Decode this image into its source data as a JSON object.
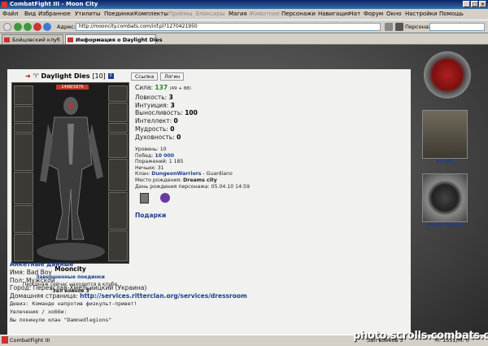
{
  "window": {
    "title": "CombatFight III - Moon City"
  },
  "menu": [
    "Файл",
    "Вид",
    "Избранное",
    "Утилиты",
    "Поединки",
    "Комплекты",
    "Приёмы",
    "Эликсиры",
    "Магия",
    "Животное",
    "Персонажи",
    "Навигация",
    "Чат",
    "Форум",
    "Окно",
    "Настройки",
    "Помощь"
  ],
  "address": {
    "label": "Адрес:",
    "url": "http://mooncity.combats.com/inf.pl?1270421950",
    "persona_label": "Персонаж:"
  },
  "tabs": [
    {
      "label": "Бойцовский клуб"
    },
    {
      "label": "Информация о Daylight Dies"
    }
  ],
  "character": {
    "name": "Daylight Dies",
    "level": "[10]",
    "hp": "1498/1870",
    "link_label": "Ссылка",
    "login_label": "Логин",
    "city": "Mooncity",
    "fights_link": "Завершенные поединки",
    "location_text": "Персонаж сейчас находится в клубе.",
    "location_room": "\"Зал воинов 3\""
  },
  "stats": [
    {
      "label": "Сила:",
      "value": "137",
      "extra": "(49 + 88)"
    },
    {
      "label": "Ловкость:",
      "value": "3",
      "extra": ""
    },
    {
      "label": "Интуиция:",
      "value": "3",
      "extra": ""
    },
    {
      "label": "Выносливость:",
      "value": "100",
      "extra": ""
    },
    {
      "label": "Интеллект:",
      "value": "0",
      "extra": ""
    },
    {
      "label": "Мудрость:",
      "value": "0",
      "extra": ""
    },
    {
      "label": "Духовность:",
      "value": "0",
      "extra": ""
    }
  ],
  "info": [
    {
      "label": "Уровень:",
      "value": "10",
      "link": false
    },
    {
      "label": "Побед:",
      "value": "10 000",
      "link": true
    },
    {
      "label": "Поражений:",
      "value": "1 185",
      "link": false
    },
    {
      "label": "Ничьих:",
      "value": "31",
      "link": false
    }
  ],
  "clan": {
    "label": "Клан:",
    "name": "DungeonWarriors",
    "rank": " - Guardiano"
  },
  "birthplace": {
    "label": "Место рождения:",
    "value": "Dreams city"
  },
  "birthday": {
    "label": "День рождения персонажа:",
    "value": "05.04.10 14:59"
  },
  "gifts_label": "Подарки",
  "personal": {
    "heading": "Анкетные данные",
    "lines": [
      {
        "label": "Имя:",
        "value": "Bad Boy"
      },
      {
        "label": "Пол:",
        "value": "Мужской"
      },
      {
        "label": "Город:",
        "value": "Переяслав-Хмельницкий (Украина)"
      },
      {
        "label": "Домашняя страница:",
        "value": "http://services.ritterclan.org/services/dressroom"
      },
      {
        "label": "Девиз:",
        "value": "Команде напротив физкульт-привет!"
      },
      {
        "label": "Увлечения / хобби:",
        "value": ""
      },
      {
        "label": "",
        "value": "Вы покинули клан \"Damnedlegions\""
      }
    ]
  },
  "sidebar": {
    "scrolls_label": "Scrolls",
    "photo_label": "Photo Scrolls"
  },
  "status": {
    "taskbar_app": "CombatFight III",
    "room": "Зал воинов 3",
    "hp": "Н: 1551/М: 0"
  },
  "watermark": "photo.scrolls.combats.com",
  "colors": {
    "link": "#1d3f8e",
    "strength_value": "#2e7d2e",
    "hp_bar": "#c0392b"
  }
}
